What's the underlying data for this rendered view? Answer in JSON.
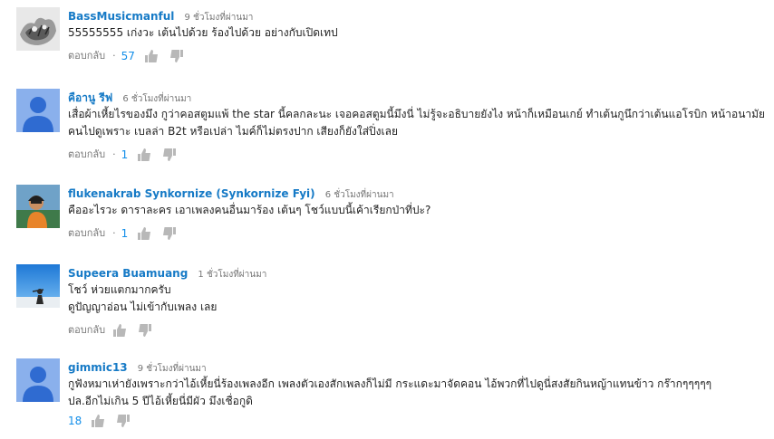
{
  "comments": [
    {
      "author": "BassMusicmanful",
      "time": "9 ชั่วโมงที่ผ่านมา",
      "lines": [
        "55555555 เก่งวะ เต้นไปด้วย ร้องไปด้วย อย่างกับเปิดเทป"
      ],
      "reply": "ตอบกลับ",
      "dot": "·",
      "likes": "57",
      "avatar": "sketch-avatar"
    },
    {
      "author": "คือานู รีฟ",
      "time": "6 ชั่วโมงที่ผ่านมา",
      "lines": [
        "เสื่อผ้าเหี้ยไรของมึง กูว่าคอสตูมแพ้ the star นี้คลกละนะ เจอคอสตูมนี้มึงนี่ ไม่รู้จะอธิบายยังไง หน้าก็เหมือนเกย์ ทำเต้นกูนึกว่าเต้นแอโรบิก หน้าอนามัย",
        "คนไปดูเพราะ เบลล่า B2t หรือเปล่า ไมค์ก็ไม่ตรงปาก เสียงก็ยังใส่ปิ่งเลย"
      ],
      "reply": "ตอบกลับ",
      "dot": "·",
      "likes": "1",
      "avatar": "default-avatar"
    },
    {
      "author": "flukenakrab Synkornize (Synkornize Fyi)",
      "time": "6 ชั่วโมงที่ผ่านมา",
      "lines": [
        "คืออะไรวะ ดาราละคร เอาเพลงคนอื่นมาร้อง เต้นๆ โชว์แบบนี้เค้าเรียกป่าที่ปะ?"
      ],
      "reply": "ตอบกลับ",
      "dot": "·",
      "likes": "1",
      "avatar": "photo-avatar"
    },
    {
      "author": "Supeera Buamuang",
      "time": "1 ชั่วโมงที่ผ่านมา",
      "lines": [
        "โชว์ ห่วยแตกมากครับ",
        "ดูปัญญาอ่อน ไม่เข้ากับเพลง เลย"
      ],
      "reply": "ตอบกลับ",
      "dot": "",
      "likes": "",
      "avatar": "sky-avatar"
    },
    {
      "author": "gimmic13",
      "time": "9 ชั่วโมงที่ผ่านมา",
      "lines": [
        "กูฟังหมาเห่ายังเพราะกว่าไอ้เหี้ยนี่ร้องเพลงอีก เพลงตัวเองสักเพลงก็ไม่มี กระแดะมาจัดคอน ไอ้พวกที่ไปดูนี่สงสัยกินหญ้าแทนข้าว กร๊ากๆๆๆๆๆ",
        "ปล.อีกไม่เกิน 5 ปีไอ้เหี้ยนี่มีผัว มึงเชื่อกูดิ"
      ],
      "reply": "",
      "dot": "",
      "likes": "18",
      "avatar": "default-avatar"
    }
  ]
}
